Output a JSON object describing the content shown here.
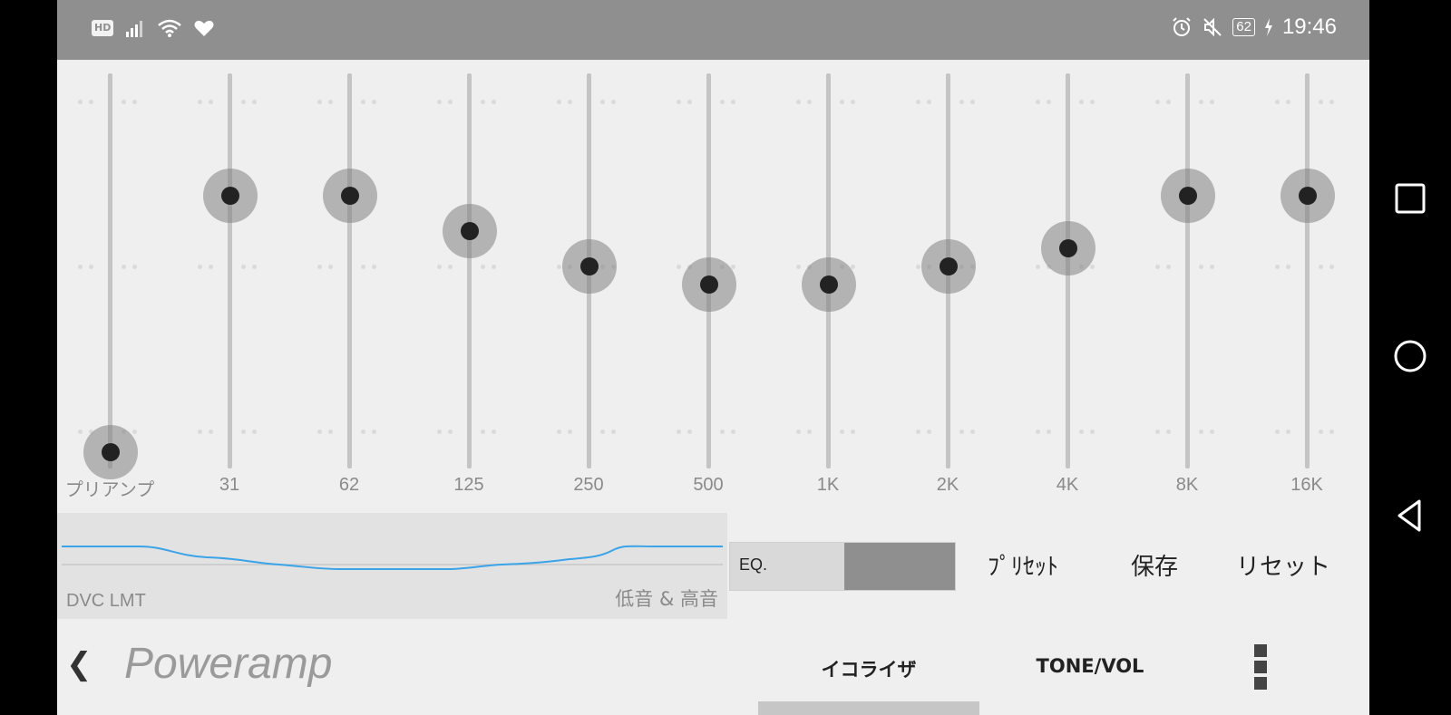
{
  "status_bar": {
    "left_icons": [
      "hd-badge",
      "signal-icon",
      "wifi-icon",
      "heart-icon"
    ],
    "hd_badge": "HD",
    "right_icons": [
      "alarm-icon",
      "mute-icon",
      "battery-icon",
      "charging-icon"
    ],
    "battery_level": "62",
    "time": "19:46"
  },
  "equalizer": {
    "bands": [
      {
        "label": "プリアンプ",
        "level": 0.03
      },
      {
        "label": "31",
        "level": 0.68
      },
      {
        "label": "62",
        "level": 0.68
      },
      {
        "label": "125",
        "level": 0.59
      },
      {
        "label": "250",
        "level": 0.5
      },
      {
        "label": "500",
        "level": 0.455
      },
      {
        "label": "1K",
        "level": 0.455
      },
      {
        "label": "2K",
        "level": 0.5
      },
      {
        "label": "4K",
        "level": 0.545
      },
      {
        "label": "8K",
        "level": 0.68
      },
      {
        "label": "16K",
        "level": 0.68
      }
    ]
  },
  "curve_panel": {
    "left_label": "DVC LMT",
    "right_label": "低音 & 高音",
    "accent_color": "#3ba3e8"
  },
  "eq_toggle": {
    "label": "EQ.",
    "state": "on"
  },
  "actions": {
    "preset": "ﾌﾟﾘｾｯﾄ",
    "save": "保存",
    "reset": "リセット"
  },
  "bottom_bar": {
    "back_icon": "chevron-left-icon",
    "app_title": "Poweramp",
    "tabs": [
      {
        "label": "イコライザ",
        "active": true
      },
      {
        "label": "TONE/VOL",
        "active": false
      }
    ],
    "more_icon": "more-vertical-icon"
  },
  "nav_bar": {
    "buttons": [
      "recents-icon",
      "home-icon",
      "back-icon"
    ]
  }
}
